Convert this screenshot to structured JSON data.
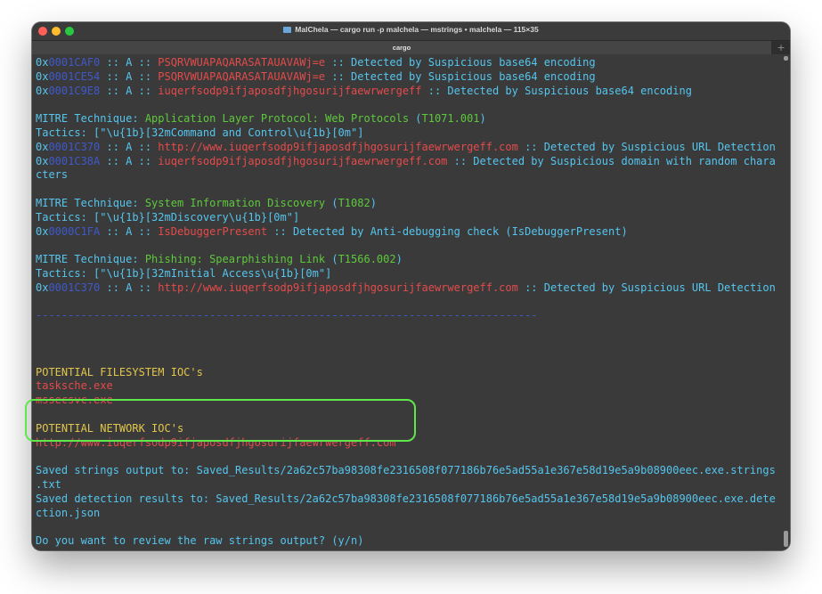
{
  "window": {
    "title": "MalChela — cargo run -p malchela — mstrings • malchela — 115×35",
    "tab_label": "cargo",
    "new_tab_glyph": "+"
  },
  "colors": {
    "white": "#dcdcdc",
    "cyan": "#55c5ee",
    "yellow": "#e2c64c",
    "red": "#e44b4b",
    "green": "#5ec93d",
    "blue": "#3f59c9",
    "highlight": "#5ee84a"
  },
  "terminal": {
    "lines": [
      [
        [
          "c-cyan",
          "0x"
        ],
        [
          "c-blue",
          "0001CAF0"
        ],
        [
          "c-cyan",
          " :: A :: "
        ],
        [
          "c-red",
          "PSQRVWUAPAQARASATAUAVAWj=e"
        ],
        [
          "c-cyan",
          " :: Detected by Suspicious base64 encoding"
        ]
      ],
      [
        [
          "c-cyan",
          "0x"
        ],
        [
          "c-blue",
          "0001CE54"
        ],
        [
          "c-cyan",
          " :: A :: "
        ],
        [
          "c-red",
          "PSQRVWUAPAQARASATAUAVAWj=e"
        ],
        [
          "c-cyan",
          " :: Detected by Suspicious base64 encoding"
        ]
      ],
      [
        [
          "c-cyan",
          "0x"
        ],
        [
          "c-blue",
          "0001C9E8"
        ],
        [
          "c-cyan",
          " :: A :: "
        ],
        [
          "c-red",
          "iuqerfsodp9ifjaposdfjhgosurijfaewrwergeff"
        ],
        [
          "c-cyan",
          " :: Detected by Suspicious base64 encoding"
        ]
      ],
      [],
      [
        [
          "c-cyan",
          "MITRE Technique: "
        ],
        [
          "c-green",
          "Application Layer Protocol: Web Protocols"
        ],
        [
          "c-cyan",
          " ("
        ],
        [
          "c-green",
          "T1071.001"
        ],
        [
          "c-cyan",
          ")"
        ]
      ],
      [
        [
          "c-cyan",
          "Tactics: [\"\\u{1b}[32mCommand and Control\\u{1b}[0m\"]"
        ]
      ],
      [
        [
          "c-cyan",
          "0x"
        ],
        [
          "c-blue",
          "0001C370"
        ],
        [
          "c-cyan",
          " :: A :: "
        ],
        [
          "c-red",
          "http://www.iuqerfsodp9ifjaposdfjhgosurijfaewrwergeff.com"
        ],
        [
          "c-cyan",
          " :: Detected by Suspicious URL Detection"
        ]
      ],
      [
        [
          "c-cyan",
          "0x"
        ],
        [
          "c-blue",
          "0001C38A"
        ],
        [
          "c-cyan",
          " :: A :: "
        ],
        [
          "c-red",
          "iuqerfsodp9ifjaposdfjhgosurijfaewrwergeff.com"
        ],
        [
          "c-cyan",
          " :: Detected by Suspicious domain with random chara"
        ]
      ],
      [
        [
          "c-cyan",
          "cters"
        ]
      ],
      [],
      [
        [
          "c-cyan",
          "MITRE Technique: "
        ],
        [
          "c-green",
          "System Information Discovery"
        ],
        [
          "c-cyan",
          " ("
        ],
        [
          "c-green",
          "T1082"
        ],
        [
          "c-cyan",
          ")"
        ]
      ],
      [
        [
          "c-cyan",
          "Tactics: [\"\\u{1b}[32mDiscovery\\u{1b}[0m\"]"
        ]
      ],
      [
        [
          "c-cyan",
          "0x"
        ],
        [
          "c-blue",
          "0000C1FA"
        ],
        [
          "c-cyan",
          " :: A :: "
        ],
        [
          "c-red",
          "IsDebuggerPresent"
        ],
        [
          "c-cyan",
          " :: Detected by Anti-debugging check (IsDebuggerPresent)"
        ]
      ],
      [],
      [
        [
          "c-cyan",
          "MITRE Technique: "
        ],
        [
          "c-green",
          "Phishing: Spearphishing Link"
        ],
        [
          "c-cyan",
          " ("
        ],
        [
          "c-green",
          "T1566.002"
        ],
        [
          "c-cyan",
          ")"
        ]
      ],
      [
        [
          "c-cyan",
          "Tactics: [\"\\u{1b}[32mInitial Access\\u{1b}[0m\"]"
        ]
      ],
      [
        [
          "c-cyan",
          "0x"
        ],
        [
          "c-blue",
          "0001C370"
        ],
        [
          "c-cyan",
          " :: A :: "
        ],
        [
          "c-red",
          "http://www.iuqerfsodp9ifjaposdfjhgosurijfaewrwergeff.com"
        ],
        [
          "c-cyan",
          " :: Detected by Suspicious URL Detection"
        ]
      ],
      [],
      [
        [
          "c-blue",
          "------------------------------------------------------------------------------"
        ]
      ],
      [],
      [],
      [],
      [
        [
          "c-yellow",
          "POTENTIAL FILESYSTEM IOC's"
        ]
      ],
      [
        [
          "c-red",
          "tasksche.exe"
        ]
      ],
      [
        [
          "c-red",
          "mssecsvc.exe"
        ]
      ],
      [],
      [
        [
          "c-yellow",
          "POTENTIAL NETWORK IOC's"
        ]
      ],
      [
        [
          "c-red",
          "http://www.iuqerfsodp9ifjaposdfjhgosurijfaewrwergeff.com"
        ]
      ],
      [],
      [
        [
          "c-cyan",
          "Saved strings output to: Saved_Results/2a62c57ba98308fe2316508f077186b76e5ad55a1e367e58d19e5a9b08900eec.exe.strings"
        ]
      ],
      [
        [
          "c-cyan",
          ".txt"
        ]
      ],
      [
        [
          "c-cyan",
          "Saved detection results to: Saved_Results/2a62c57ba98308fe2316508f077186b76e5ad55a1e367e58d19e5a9b08900eec.exe.dete"
        ]
      ],
      [
        [
          "c-cyan",
          "ction.json"
        ]
      ],
      [],
      [
        [
          "c-cyan",
          "Do you want to review the raw strings output? (y/n)"
        ]
      ]
    ]
  }
}
